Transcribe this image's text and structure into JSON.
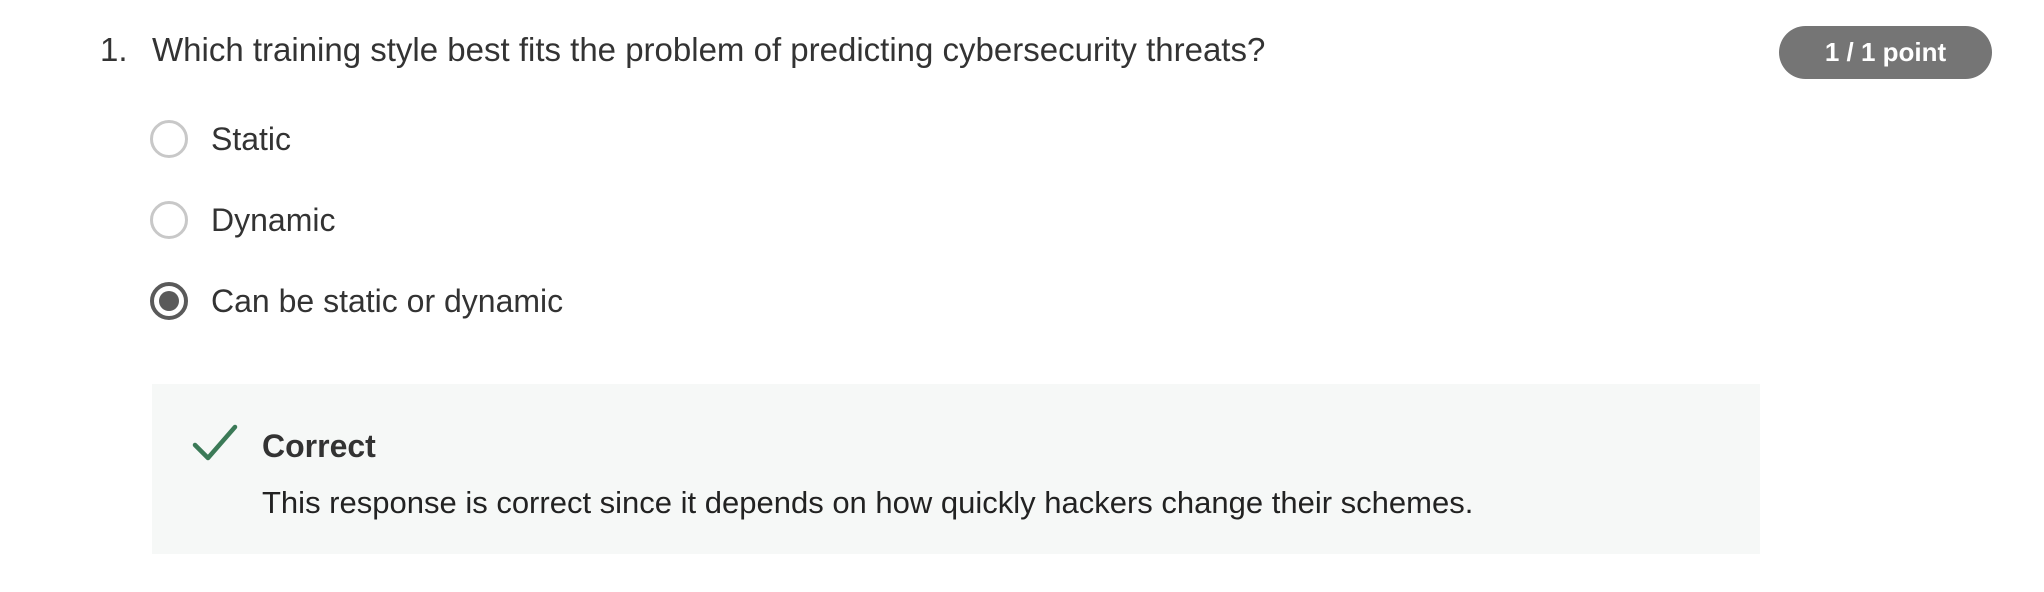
{
  "question": {
    "number": "1.",
    "text": "Which training style best fits the problem of predicting cybersecurity threats?",
    "points": "1 / 1 point"
  },
  "options": [
    {
      "label": "Static",
      "selected": false
    },
    {
      "label": "Dynamic",
      "selected": false
    },
    {
      "label": "Can be static or dynamic",
      "selected": true
    }
  ],
  "feedback": {
    "status": "Correct",
    "message": "This response is correct since it depends on how quickly hackers change their schemes.",
    "icon": "checkmark-icon"
  },
  "colors": {
    "badge_bg": "#757575",
    "check": "#3b7a57",
    "feedback_bg": "#f6f8f7",
    "radio_selected": "#5a5a5a"
  }
}
